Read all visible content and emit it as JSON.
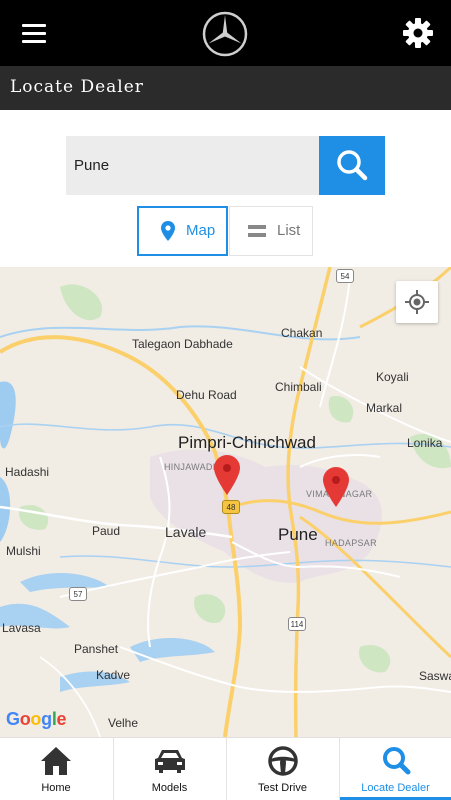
{
  "header": {
    "menu_icon": "hamburger-menu-icon",
    "logo": "mercedes-star-logo",
    "settings_icon": "gear-icon"
  },
  "title_bar": {
    "title": "Locate Dealer"
  },
  "search": {
    "value": "Pune",
    "button_icon": "search-icon"
  },
  "view_toggle": {
    "map_label": "Map",
    "map_icon": "location-pin-icon",
    "list_label": "List",
    "list_icon": "list-icon",
    "selected": "Map"
  },
  "map": {
    "places": [
      "Chakan",
      "Talegaon Dabhade",
      "Chimbali",
      "Koyali",
      "Dehu Road",
      "Markal",
      "Pimpri-Chinchwad",
      "Lonika",
      "Hadashi",
      "HINJAWADI",
      "VIMAN NAGAR",
      "Paud",
      "Lavale",
      "Pune",
      "HADAPSAR",
      "Mulshi",
      "Lavasa",
      "Panshet",
      "Kadve",
      "Saswa",
      "Velhe"
    ],
    "highway_shields": [
      "54",
      "48",
      "57",
      "114"
    ],
    "locate_me_icon": "my-location-icon",
    "dealer_markers": 2,
    "attribution": "Google"
  },
  "bottom_nav": {
    "items": [
      {
        "label": "Home",
        "icon": "home-icon"
      },
      {
        "label": "Models",
        "icon": "car-icon"
      },
      {
        "label": "Test Drive",
        "icon": "steering-wheel-icon"
      },
      {
        "label": "Locate Dealer",
        "icon": "search-icon"
      }
    ],
    "active": "Locate Dealer"
  },
  "colors": {
    "accent": "#1f8fe6",
    "header_bg": "#000000",
    "titlebar_bg": "#2b2b2b",
    "marker": "#e53935"
  }
}
